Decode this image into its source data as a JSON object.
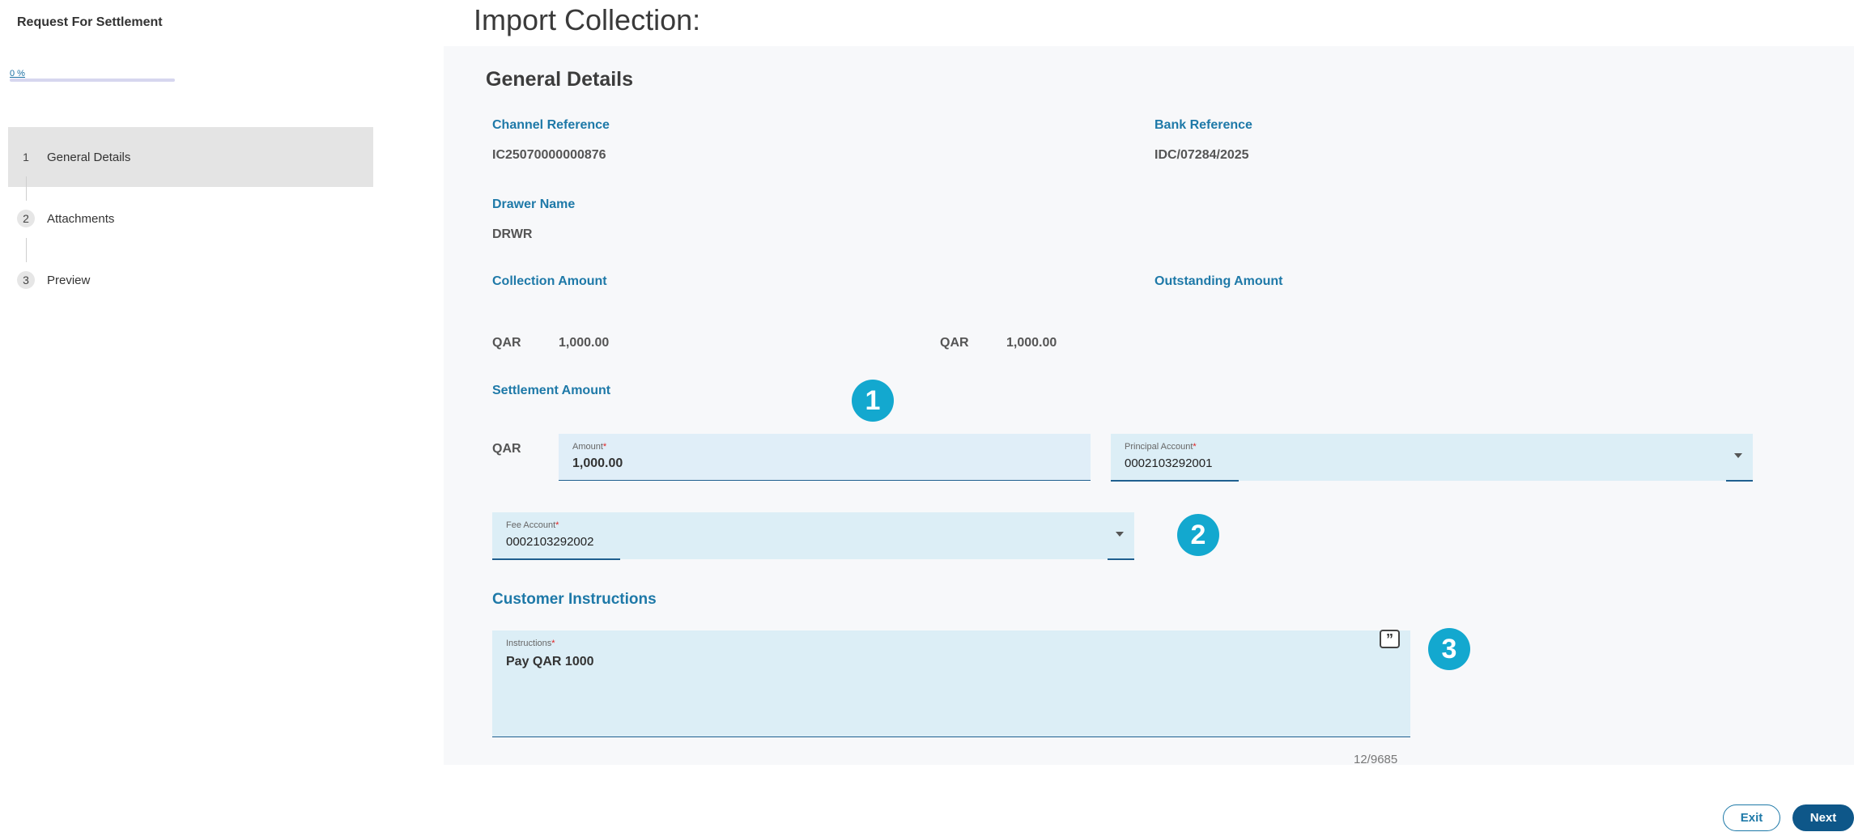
{
  "sidebar": {
    "title": "Request For Settlement",
    "progress": {
      "label": "0 %",
      "value": 0
    },
    "steps": [
      {
        "number": "1",
        "label": "General Details",
        "active": true
      },
      {
        "number": "2",
        "label": "Attachments",
        "active": false
      },
      {
        "number": "3",
        "label": "Preview",
        "active": false
      }
    ]
  },
  "main": {
    "page_title": "Import Collection:",
    "section_title": "General Details",
    "channel_reference": {
      "label": "Channel Reference",
      "value": "IC25070000000876"
    },
    "bank_reference": {
      "label": "Bank Reference",
      "value": "IDC/07284/2025"
    },
    "drawer_name": {
      "label": "Drawer Name",
      "value": "DRWR"
    },
    "collection_amount": {
      "label": "Collection Amount",
      "currency": "QAR",
      "value": "1,000.00"
    },
    "outstanding_amount": {
      "label": "Outstanding Amount",
      "currency": "QAR",
      "value": "1,000.00"
    },
    "settlement_amount": {
      "label": "Settlement Amount",
      "currency": "QAR",
      "amount_field": {
        "label": "Amount",
        "value": "1,000.00"
      }
    },
    "principal_account": {
      "label": "Principal Account",
      "value": "0002103292001"
    },
    "fee_account": {
      "label": "Fee Account",
      "value": "0002103292002"
    },
    "customer_instructions": {
      "title": "Customer Instructions",
      "field_label": "Instructions",
      "value": "Pay QAR 1000",
      "counter": "12/9685",
      "quote_icon": "quote-icon"
    },
    "required_marker": "*",
    "badges": [
      "1",
      "2",
      "3"
    ]
  },
  "footer": {
    "exit_label": "Exit",
    "next_label": "Next"
  },
  "colors": {
    "accent": "#1e79a8",
    "primary_button": "#0e5789",
    "badge": "#13a8cf",
    "field_bg": "#e0eef8"
  }
}
